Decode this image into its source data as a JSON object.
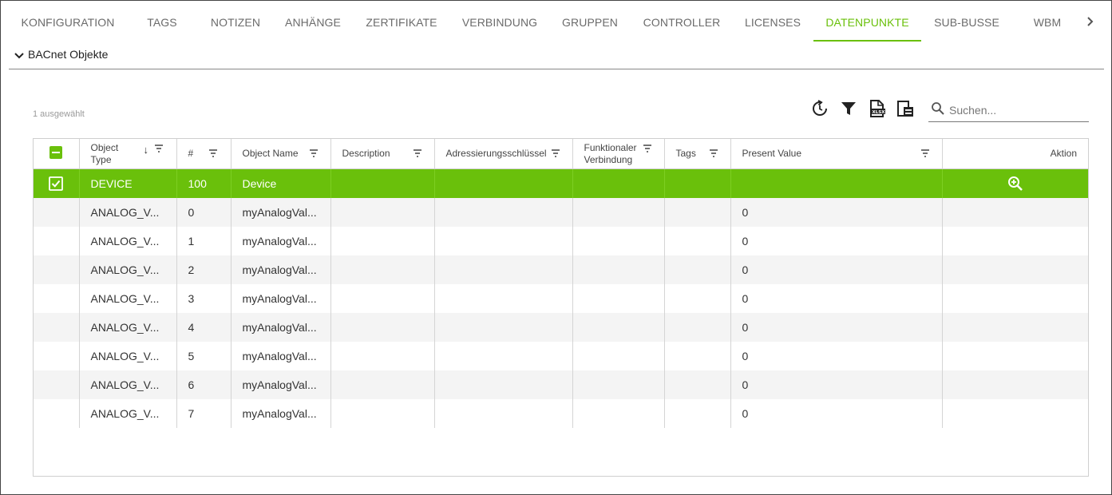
{
  "tabs": [
    {
      "label": "KONFIGURATION"
    },
    {
      "label": "TAGS"
    },
    {
      "label": "NOTIZEN"
    },
    {
      "label": "ANHÄNGE"
    },
    {
      "label": "ZERTIFIKATE"
    },
    {
      "label": "VERBINDUNG"
    },
    {
      "label": "GRUPPEN"
    },
    {
      "label": "CONTROLLER"
    },
    {
      "label": "LICENSES"
    },
    {
      "label": "DATENPUNKTE"
    },
    {
      "label": "SUB-BUSSE"
    },
    {
      "label": "WBM"
    }
  ],
  "active_tab": "DATENPUNKTE",
  "accent_color": "#6ac00b",
  "section": {
    "title": "BACnet Objekte",
    "icon": "chevron-down-icon"
  },
  "toolbar": {
    "selected_count": "1 ausgewählt",
    "icons": [
      "refresh-icon",
      "filter-icon",
      "export-xlsx-icon",
      "column-settings-icon"
    ],
    "search_placeholder": "Suchen..."
  },
  "table": {
    "columns": [
      {
        "label": ""
      },
      {
        "label": "Object Type",
        "sorted": "desc"
      },
      {
        "label": "#"
      },
      {
        "label": "Object Name"
      },
      {
        "label": "Description"
      },
      {
        "label": "Adressierungsschlüssel"
      },
      {
        "label": "Funktionaler Verbindung"
      },
      {
        "label": "Tags"
      },
      {
        "label": "Present Value"
      },
      {
        "label": "Aktion"
      }
    ],
    "rows": [
      {
        "type": "DEVICE",
        "num": "100",
        "name": "Device",
        "description": "",
        "address": "",
        "func": "",
        "tags": "",
        "value": "",
        "selected": true
      },
      {
        "type": "ANALOG_V...",
        "num": "0",
        "name": "myAnalogVal...",
        "description": "",
        "address": "",
        "func": "",
        "tags": "",
        "value": "0",
        "selected": false
      },
      {
        "type": "ANALOG_V...",
        "num": "1",
        "name": "myAnalogVal...",
        "description": "",
        "address": "",
        "func": "",
        "tags": "",
        "value": "0",
        "selected": false
      },
      {
        "type": "ANALOG_V...",
        "num": "2",
        "name": "myAnalogVal...",
        "description": "",
        "address": "",
        "func": "",
        "tags": "",
        "value": "0",
        "selected": false
      },
      {
        "type": "ANALOG_V...",
        "num": "3",
        "name": "myAnalogVal...",
        "description": "",
        "address": "",
        "func": "",
        "tags": "",
        "value": "0",
        "selected": false
      },
      {
        "type": "ANALOG_V...",
        "num": "4",
        "name": "myAnalogVal...",
        "description": "",
        "address": "",
        "func": "",
        "tags": "",
        "value": "0",
        "selected": false
      },
      {
        "type": "ANALOG_V...",
        "num": "5",
        "name": "myAnalogVal...",
        "description": "",
        "address": "",
        "func": "",
        "tags": "",
        "value": "0",
        "selected": false
      },
      {
        "type": "ANALOG_V...",
        "num": "6",
        "name": "myAnalogVal...",
        "description": "",
        "address": "",
        "func": "",
        "tags": "",
        "value": "0",
        "selected": false
      },
      {
        "type": "ANALOG_V...",
        "num": "7",
        "name": "myAnalogVal...",
        "description": "",
        "address": "",
        "func": "",
        "tags": "",
        "value": "0",
        "selected": false
      }
    ]
  }
}
